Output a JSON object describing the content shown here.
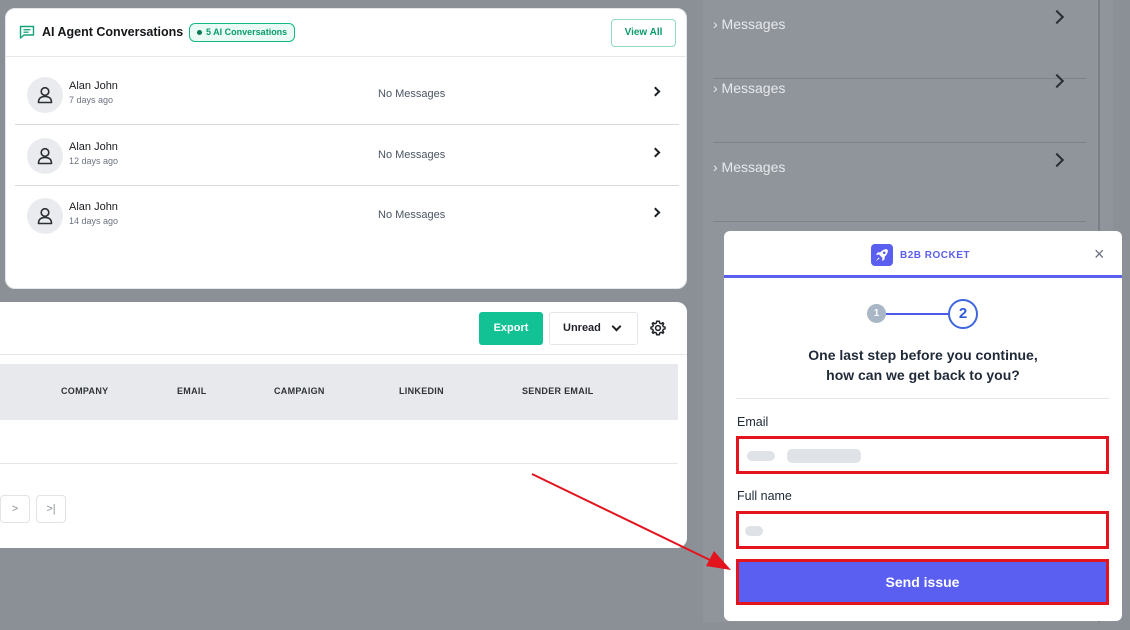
{
  "background": {
    "rows": [
      {
        "text": "› Messages"
      },
      {
        "text": "› Messages"
      },
      {
        "text": "› Messages"
      }
    ]
  },
  "conversations": {
    "title": "AI Agent Conversations",
    "badge": "5 AI Conversations",
    "view_all": "View All",
    "items": [
      {
        "name": "Alan John",
        "time": "7 days ago",
        "message": "No Messages"
      },
      {
        "name": "Alan John",
        "time": "12 days ago",
        "message": "No Messages"
      },
      {
        "name": "Alan John",
        "time": "14 days ago",
        "message": "No Messages"
      }
    ]
  },
  "table": {
    "export_label": "Export",
    "filter_label": "Unread",
    "columns": [
      "COMPANY",
      "EMAIL",
      "CAMPAIGN",
      "LINKEDIN",
      "SENDER EMAIL"
    ],
    "pagination": [
      ">",
      ">|"
    ]
  },
  "widget": {
    "brand": "B2B ROCKET",
    "close": "×",
    "step1": "1",
    "step2": "2",
    "heading_line1": "One last step before you continue,",
    "heading_line2": "how can we get back to you?",
    "email_label": "Email",
    "fullname_label": "Full name",
    "send_label": "Send issue"
  },
  "colors": {
    "accent": "#5a5ff2",
    "green": "#12c295",
    "highlight": "#e3141d"
  }
}
